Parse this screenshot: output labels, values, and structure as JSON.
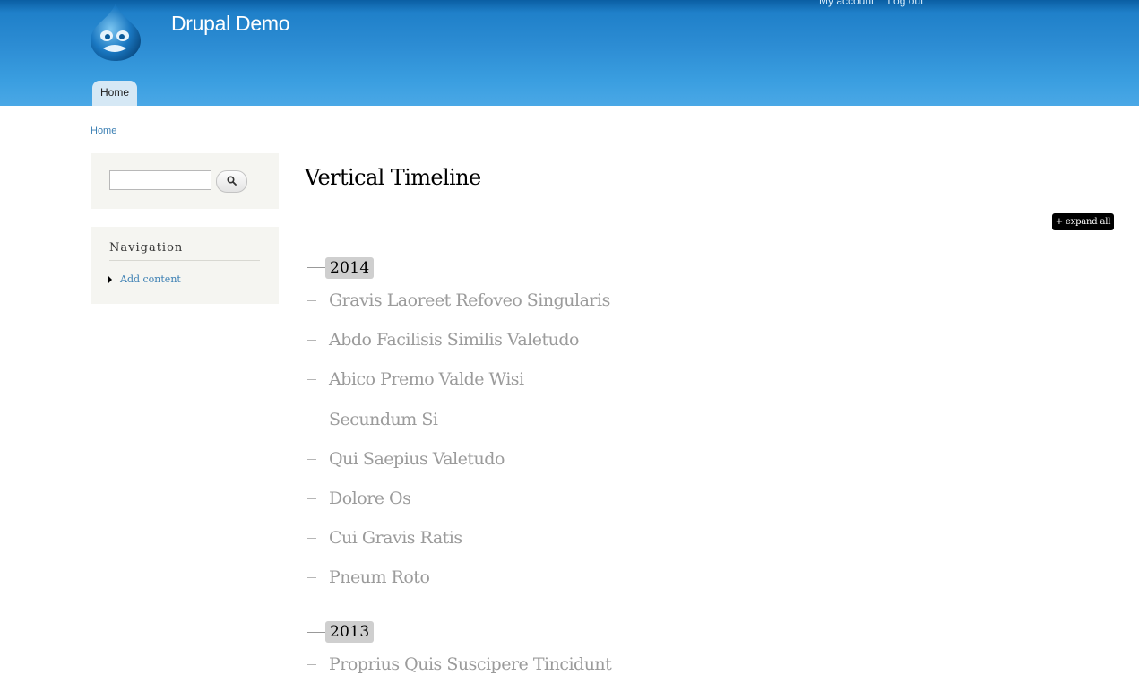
{
  "header": {
    "site_name": "Drupal Demo",
    "secondary_menu": [
      "My account",
      "Log out"
    ],
    "main_menu": [
      "Home"
    ]
  },
  "breadcrumb": "Home",
  "sidebar": {
    "search": {
      "placeholder": "",
      "value": ""
    },
    "navigation": {
      "title": "Navigation",
      "items": [
        "Add content"
      ]
    }
  },
  "main": {
    "title": "Vertical Timeline",
    "expand_all_label": "+ expand all",
    "timeline": [
      {
        "year": "2014",
        "items": [
          "Gravis Laoreet Refoveo Singularis",
          "Abdo Facilisis Similis Valetudo",
          "Abico Premo Valde Wisi",
          "Secundum Si",
          "Qui Saepius Valetudo",
          "Dolore Os",
          "Cui Gravis Ratis",
          "Pneum Roto"
        ]
      },
      {
        "year": "2013",
        "items": [
          "Proprius Quis Suscipere Tincidunt"
        ]
      }
    ]
  },
  "colors": {
    "header_blue": "#2c8cd3",
    "link_blue": "#3b7fb3",
    "timeline_text": "#9b9b9b",
    "year_badge": "#cfcfcf"
  }
}
